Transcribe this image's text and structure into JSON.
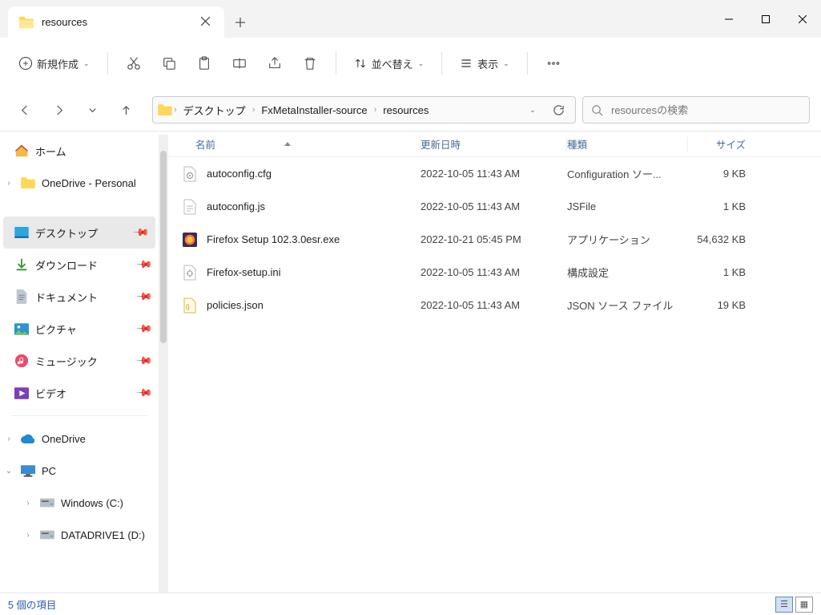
{
  "window": {
    "tab_title": "resources"
  },
  "toolbar": {
    "new_label": "新規作成",
    "sort_label": "並べ替え",
    "view_label": "表示"
  },
  "breadcrumbs": [
    "デスクトップ",
    "FxMetaInstaller-source",
    "resources"
  ],
  "search": {
    "placeholder": "resourcesの検索"
  },
  "sidebar": [
    {
      "label": "ホーム",
      "icon": "home"
    },
    {
      "label": "OneDrive - Personal",
      "icon": "folder-yellow",
      "expandable": true
    },
    {
      "gap": true
    },
    {
      "label": "デスクトップ",
      "icon": "desktop",
      "pinned": true,
      "selected": true
    },
    {
      "label": "ダウンロード",
      "icon": "download",
      "pinned": true
    },
    {
      "label": "ドキュメント",
      "icon": "document",
      "pinned": true
    },
    {
      "label": "ピクチャ",
      "icon": "picture",
      "pinned": true
    },
    {
      "label": "ミュージック",
      "icon": "music",
      "pinned": true
    },
    {
      "label": "ビデオ",
      "icon": "video",
      "pinned": true
    },
    {
      "hr": true
    },
    {
      "label": "OneDrive",
      "icon": "onedrive",
      "expandable": true
    },
    {
      "label": "PC",
      "icon": "pc",
      "expandable": true,
      "expanded": true
    },
    {
      "label": "Windows  (C:)",
      "icon": "drive",
      "sub": true,
      "expandable": true
    },
    {
      "label": "DATADRIVE1 (D:)",
      "icon": "drive",
      "sub": true,
      "expandable": true
    }
  ],
  "columns": {
    "name": "名前",
    "date": "更新日時",
    "type": "種類",
    "size": "サイズ"
  },
  "files": [
    {
      "name": "autoconfig.cfg",
      "date": "2022-10-05 11:43 AM",
      "type": "Configuration ソー...",
      "size": "9 KB",
      "icon": "cfg"
    },
    {
      "name": "autoconfig.js",
      "date": "2022-10-05 11:43 AM",
      "type": "JSFile",
      "size": "1 KB",
      "icon": "txt"
    },
    {
      "name": "Firefox Setup 102.3.0esr.exe",
      "date": "2022-10-21 05:45 PM",
      "type": "アプリケーション",
      "size": "54,632 KB",
      "icon": "ff"
    },
    {
      "name": "Firefox-setup.ini",
      "date": "2022-10-05 11:43 AM",
      "type": "構成設定",
      "size": "1 KB",
      "icon": "ini"
    },
    {
      "name": "policies.json",
      "date": "2022-10-05 11:43 AM",
      "type": "JSON ソース ファイル",
      "size": "19 KB",
      "icon": "json"
    }
  ],
  "status": "5 個の項目"
}
